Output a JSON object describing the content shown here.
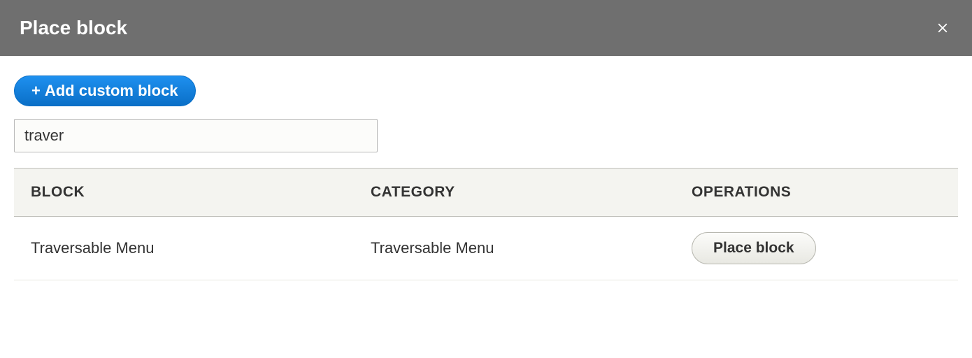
{
  "modal": {
    "title": "Place block"
  },
  "actions": {
    "add_custom_block": "Add custom block"
  },
  "filter": {
    "value": "traver"
  },
  "table": {
    "headers": {
      "block": "Block",
      "category": "Category",
      "operations": "Operations"
    },
    "rows": [
      {
        "block": "Traversable Menu",
        "category": "Traversable Menu",
        "op_label": "Place block"
      }
    ]
  }
}
